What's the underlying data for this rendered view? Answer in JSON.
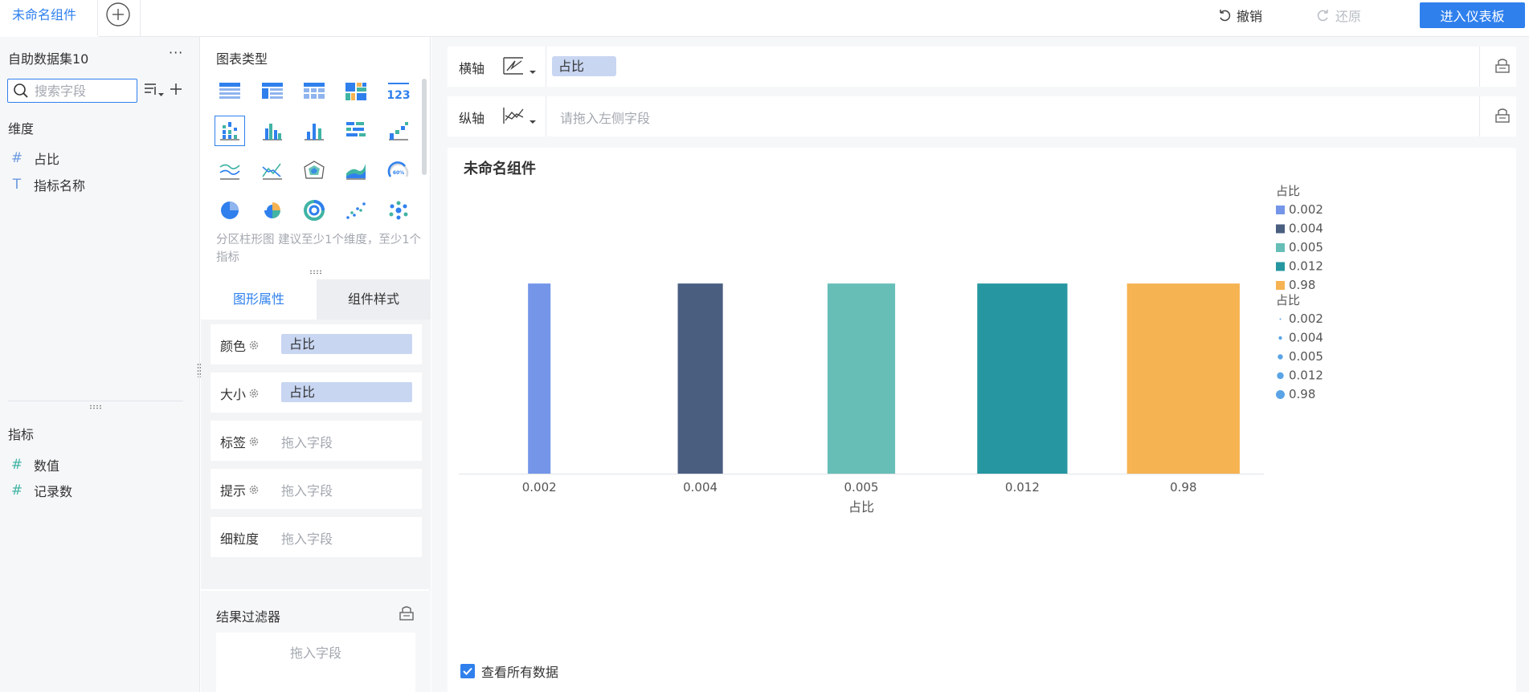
{
  "topbar": {
    "active_tab": "未命名组件",
    "undo_label": "撤销",
    "redo_label": "还原",
    "enter_dashboard": "进入仪表板"
  },
  "left": {
    "dataset": "自助数据集10",
    "more": "···",
    "search_placeholder": "搜索字段",
    "dimension_label": "维度",
    "dimensions": [
      {
        "icon": "#",
        "label": "占比"
      },
      {
        "icon": "T",
        "label": "指标名称"
      }
    ],
    "metric_label": "指标",
    "metrics": [
      {
        "icon": "#",
        "label": "数值"
      },
      {
        "icon": "#",
        "label": "记录数"
      }
    ]
  },
  "mid": {
    "chart_type_title": "图表类型",
    "chart_desc": "分区柱形图 建议至少1个维度，至少1个指标",
    "tab_graph_props": "图形属性",
    "tab_component_style": "组件样式",
    "props": [
      {
        "label": "颜色",
        "value": "占比",
        "placeholder": ""
      },
      {
        "label": "大小",
        "value": "占比",
        "placeholder": ""
      },
      {
        "label": "标签",
        "value": "",
        "placeholder": "拖入字段"
      },
      {
        "label": "提示",
        "value": "",
        "placeholder": "拖入字段"
      },
      {
        "label": "细粒度",
        "value": "",
        "placeholder": "拖入字段"
      }
    ],
    "result_filter_title": "结果过滤器",
    "result_filter_placeholder": "拖入字段"
  },
  "workspace": {
    "x_axis_label": "横轴",
    "x_axis_field": "占比",
    "y_axis_label": "纵轴",
    "y_axis_placeholder": "请拖入左侧字段",
    "view_all_label": "查看所有数据"
  },
  "colors": {
    "accent": "#2f80ed",
    "pill": "#c8d6f2"
  },
  "chart_data": {
    "type": "bar",
    "title": "未命名组件",
    "xlabel": "占比",
    "ylabel": "",
    "categories": [
      "0.002",
      "0.004",
      "0.005",
      "0.012",
      "0.98"
    ],
    "values": [
      1,
      1,
      1,
      1,
      1
    ],
    "ylim": [
      0,
      1.52
    ],
    "grid": false,
    "bar_colors": [
      "#7495e8",
      "#4a5e80",
      "#66beb7",
      "#2697a0",
      "#f6b352"
    ],
    "bar_width_fraction": [
      0.14,
      0.28,
      0.42,
      0.56,
      0.7
    ],
    "legend": {
      "placement": "right",
      "color_title": "占比",
      "color_items": [
        "0.002",
        "0.004",
        "0.005",
        "0.012",
        "0.98"
      ],
      "size_title": "占比",
      "size_items": [
        "0.002",
        "0.004",
        "0.005",
        "0.012",
        "0.98"
      ]
    }
  }
}
